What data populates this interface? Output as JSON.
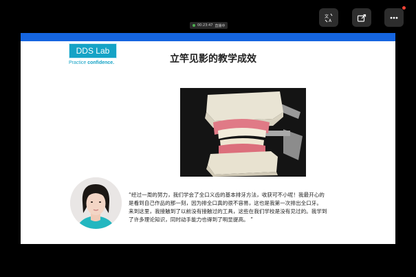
{
  "meeting": {
    "recording_time": "00:23:47",
    "recording_status": "直播中"
  },
  "colors": {
    "slide_top_bar": "#1565e0",
    "logo_teal": "#15a3c6",
    "toolbar_button": "#2d2d2d",
    "notification": "#f44336"
  },
  "toolbar": {
    "icons": [
      "translate-icon",
      "share-screen-icon",
      "more-options-icon"
    ]
  },
  "slide": {
    "logo": "DDS Lab",
    "tagline_regular": "Practice ",
    "tagline_bold": "confidence.",
    "title": "立竿见影的教学成效",
    "quote_lines": [
      "“经过一周的努力，我们学会了全口义齿的基本排牙方法，收获可不小呢！我最开心的",
      "是看到自己作品的那一刻，因为排全口真的很不容易，这也是我第一次排出全口牙。",
      "来到这里，我接触到了以前没有接触过的工具，这些在我们学校是没有见过的。我学到",
      "了许多理论知识，同时动手能力也得到了明显提高。  ”"
    ]
  }
}
